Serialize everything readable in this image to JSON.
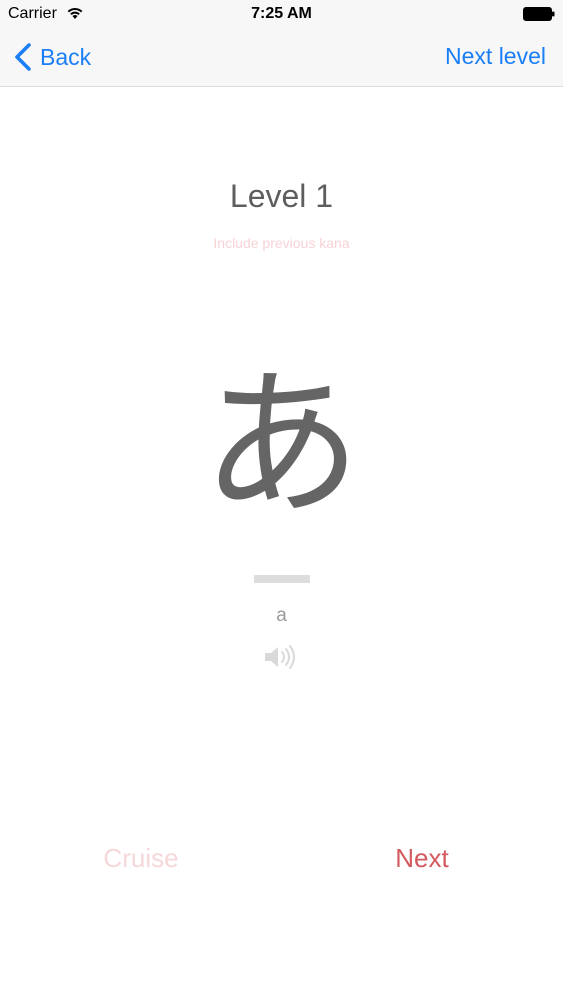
{
  "status_bar": {
    "carrier": "Carrier",
    "time": "7:25 AM",
    "wifi_icon": "wifi-icon",
    "battery_icon": "battery-icon"
  },
  "nav": {
    "back_label": "Back",
    "back_icon": "chevron-left-icon",
    "next_level_label": "Next level",
    "accent_color": "#1a7ef4"
  },
  "content": {
    "level_title": "Level 1",
    "include_previous": "Include previous kana",
    "kana": "あ",
    "romaji": "a",
    "speaker_icon": "speaker-icon"
  },
  "footer": {
    "cruise_label": "Cruise",
    "next_label": "Next",
    "next_color": "#d35a5f",
    "cruise_color": "#f6d8da"
  }
}
